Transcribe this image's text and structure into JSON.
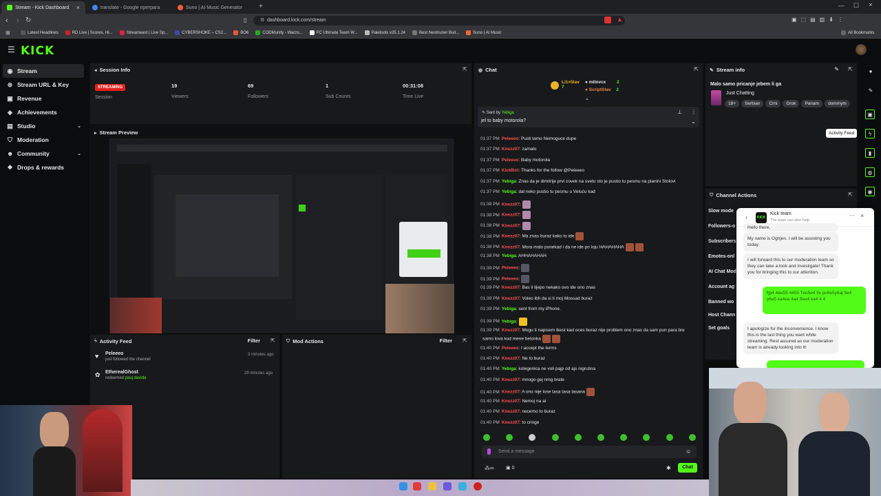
{
  "browser": {
    "tabs": [
      {
        "label": "Stream - Kick Dashboard",
        "color": "#53fc18"
      },
      {
        "label": "translate - Google претрага",
        "color": "#4285f4"
      },
      {
        "label": "Suno | AI Music Generator",
        "color": "#ff5a36"
      }
    ],
    "url": "dashboard.kick.com/stream",
    "bookmarks": [
      "Latest Headlines",
      "RD Live | Scores, Hi...",
      "Streameast | Live Sp...",
      "CYBERSHOKE – CS2...",
      "BO6",
      "CODMunity - Warzo...",
      "FC Ultimate Team W...",
      "Paletools v25.1.24",
      "Best Nextnuner Buil...",
      "Suno | AI Music"
    ],
    "all_bookmarks": "All Bookmarks"
  },
  "app": {
    "logo": "KICK",
    "accent": "#53fc18"
  },
  "sidebar": {
    "items": [
      {
        "label": "Stream",
        "icon": "broadcast-icon"
      },
      {
        "label": "Stream URL & Key",
        "icon": "key-icon"
      },
      {
        "label": "Revenue",
        "icon": "money-icon"
      },
      {
        "label": "Achievements",
        "icon": "trophy-icon"
      },
      {
        "label": "Studio",
        "icon": "studio-icon"
      },
      {
        "label": "Moderation",
        "icon": "shield-icon"
      },
      {
        "label": "Community",
        "icon": "users-icon"
      },
      {
        "label": "Drops & rewards",
        "icon": "gift-icon"
      }
    ]
  },
  "session": {
    "title": "Session Info",
    "status": "STREAMING",
    "status_label": "Session",
    "viewers": "19",
    "viewers_label": "Viewers",
    "followers": "69",
    "followers_label": "Followers",
    "subs": "1",
    "subs_label": "Sub Counts",
    "time": "00:31:08",
    "time_label": "Time Live"
  },
  "preview": {
    "title": "Stream Preview"
  },
  "activity": {
    "title": "Activity Feed",
    "filter": "Filter",
    "items": [
      {
        "user": "Peleeeo",
        "text": "just followed the channel",
        "time": "3 minutes ago"
      },
      {
        "user": "EtherealGhost",
        "text": "redeemed",
        "reward": "pauj davida",
        "time": "29 minutes ago"
      }
    ]
  },
  "mod": {
    "title": "Mod Actions",
    "filter": "Filter"
  },
  "chat": {
    "title": "Chat",
    "leaders": [
      {
        "name": "Li1×5lav",
        "count": "7"
      },
      {
        "name": "mltnvcx",
        "count": "2"
      },
      {
        "name": "ScriptSlav",
        "count": "2"
      }
    ],
    "pinned_by_label": "Sent by",
    "pinned_by": "Yebiga",
    "pinned_text": "jel to baby motorola?",
    "messages": [
      {
        "time": "01:37 PM",
        "user": "Peleeeo",
        "text": ": Pusti tamo Nemoguce dupe",
        "color": "#ff4d4d"
      },
      {
        "time": "01:37 PM",
        "user": "Knezz07",
        "text": ": zamalo",
        "color": "#ff4d4d"
      },
      {
        "time": "01:37 PM",
        "user": "Peleeeo",
        "text": ": Baby motorola",
        "color": "#ff4d4d"
      },
      {
        "time": "01:37 PM",
        "user": "KickBot",
        "text": ": Thanks for the follow @Peleeeo",
        "color": "#ff4d4d"
      },
      {
        "time": "01:37 PM",
        "user": "Yebiga",
        "text": ": Znas da je dimitrije prvi covek na svetu sto je pustio tu pesmu na planini Stolovi",
        "color": "#53fc18"
      },
      {
        "time": "01:37 PM",
        "user": "Yebiga",
        "text": ": dal neko pustio tu pesmu u Veluću kad",
        "color": "#53fc18"
      },
      {
        "time": "01:38 PM",
        "user": "Knezz07",
        "text": ":",
        "color": "#ff4d4d"
      },
      {
        "time": "01:38 PM",
        "user": "Knezz07",
        "text": ":",
        "color": "#ff4d4d"
      },
      {
        "time": "01:38 PM",
        "user": "Knezz07",
        "text": ":",
        "color": "#ff4d4d"
      },
      {
        "time": "01:38 PM",
        "user": "Knezz07",
        "text": ": Ma znas buraz kako to ide",
        "color": "#ff4d4d"
      },
      {
        "time": "01:38 PM",
        "user": "Knezz07",
        "text": ": Mora malo ponekad i da ne ide po loju HAHAHAHA",
        "color": "#ff4d4d"
      },
      {
        "time": "01:38 PM",
        "user": "Yebiga",
        "text": ": AHHAHAHAH",
        "color": "#53fc18"
      },
      {
        "time": "01:39 PM",
        "user": "Peleeeo",
        "text": ":",
        "color": "#ff4d4d"
      },
      {
        "time": "01:39 PM",
        "user": "Peleeeo",
        "text": ":",
        "color": "#ff4d4d"
      },
      {
        "time": "01:39 PM",
        "user": "Knezz07",
        "text": ": Bas li lijepo nekako ovo ide ono znas",
        "color": "#ff4d4d"
      },
      {
        "time": "01:39 PM",
        "user": "Knezz07",
        "text": ": Voleo ibh da si ti moj Mossad buraz",
        "color": "#ff4d4d"
      },
      {
        "time": "01:39 PM",
        "user": "Yebiga",
        "text": ": sent from my iPhone.",
        "color": "#53fc18"
      },
      {
        "time": "01:39 PM",
        "user": "Yebiga",
        "text": ":",
        "color": "#53fc18"
      },
      {
        "time": "01:39 PM",
        "user": "Knezz07",
        "text": ": Mogu ti napisem tkest kad oces buraz nije problem ono znas da sam pun para bre",
        "color": "#ff4d4d"
      },
      {
        "time": "",
        "user": "",
        "text": "samo lova kod mene betonka",
        "color": "#ff4d4d"
      },
      {
        "time": "01:40 PM",
        "user": "Peleeeo",
        "text": ": I accept the terms",
        "color": "#ff4d4d"
      },
      {
        "time": "01:40 PM",
        "user": "Knezz07",
        "text": ": Ne to buraz",
        "color": "#ff4d4d"
      },
      {
        "time": "01:40 PM",
        "user": "Yebiga",
        "text": ": kolegenica ne voli pajp od ajs nigrutina",
        "color": "#53fc18"
      },
      {
        "time": "01:40 PM",
        "user": "Knezz07",
        "text": ": mnogo gej nmg brate",
        "color": "#ff4d4d"
      },
      {
        "time": "01:40 PM",
        "user": "Knezz07",
        "text": ": A ono nije lose tasa tasa tasana",
        "color": "#ff4d4d"
      },
      {
        "time": "01:40 PM",
        "user": "Knezz07",
        "text": ": Nemoj na ai",
        "color": "#ff4d4d"
      },
      {
        "time": "01:40 PM",
        "user": "Knezz07",
        "text": ": necemo to buraz",
        "color": "#ff4d4d"
      },
      {
        "time": "01:40 PM",
        "user": "Knezz07",
        "text": ": to cringe",
        "color": "#ff4d4d"
      }
    ],
    "placeholder": "Send a message",
    "send": "Chat",
    "points": "0"
  },
  "stream_info": {
    "title": "Stream info",
    "stream_title": "Malo samo pricanje jebem li ga",
    "category": "Just Chatting",
    "tags": [
      "18+",
      "Serbian",
      "Crni",
      "Grok",
      "Panam",
      "dommym"
    ]
  },
  "tooltip": "Activity Feed",
  "channel_actions": {
    "title": "Channel Actions",
    "items": [
      "Slow mode",
      "Followers-o",
      "Subscribers",
      "Emotes-onl",
      "AI Chat Mod",
      "Account ag",
      "Banned wo",
      "Host Chann",
      "Set goals"
    ]
  },
  "support": {
    "name": "Kick team",
    "subtitle": "The team can also help",
    "messages": [
      {
        "side": "in",
        "text": "Hello there,"
      },
      {
        "side": "in",
        "text": "My name is Ognjen. I will be assisting you today."
      },
      {
        "side": "in",
        "text": "I will forward this to our moderation team so they can take a look and investigate! Thank you for bringing this to our attention."
      },
      {
        "side": "out",
        "text": "ђр4 4ен55 4455 Тен5е4 5к ро6е5у6ај 5е4 у6а5 ка4ен 4а4 бен4 ка4 4 4"
      },
      {
        "side": "in",
        "text": "I apologize for the inconvenience. I know this is the last thing you want while streaming. Rest assured as our moderation team is already looking into it!"
      }
    ]
  }
}
